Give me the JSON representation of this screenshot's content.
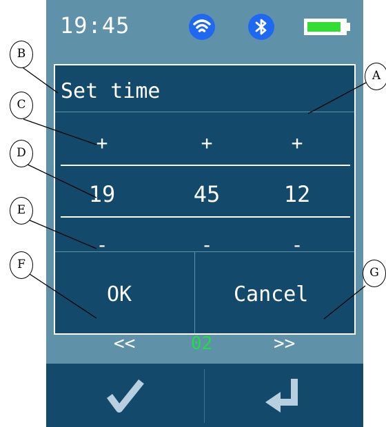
{
  "status_bar": {
    "time": "19:45",
    "icons": [
      "wifi-icon",
      "bluetooth-icon",
      "battery-icon"
    ],
    "battery_level": 0.92,
    "colors": {
      "wifi_badge": "#1f68f2",
      "bluetooth_badge": "#1f68f2",
      "battery_fill": "#33dd33"
    }
  },
  "dialog": {
    "title": "Set time",
    "increment_label": "+",
    "decrement_label": "-",
    "fields": [
      {
        "value": "19"
      },
      {
        "value": "45"
      },
      {
        "value": "12"
      }
    ],
    "ok_label": "OK",
    "cancel_label": "Cancel"
  },
  "background_screen": {
    "prev_label": "<<",
    "next_label": ">>",
    "page_number": "02",
    "page_number_color": "#22dd44"
  },
  "bottom_bar": {
    "icons": [
      "checkmark-icon",
      "enter-arrow-icon"
    ]
  },
  "callouts": [
    "A",
    "B",
    "C",
    "D",
    "E",
    "F",
    "G"
  ],
  "colors": {
    "device_background": "#5f91a9",
    "dialog_background": "#134a6c"
  }
}
